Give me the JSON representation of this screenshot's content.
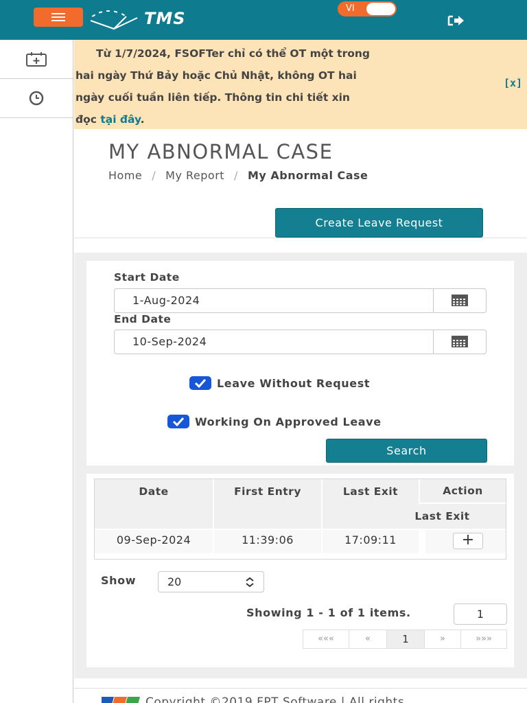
{
  "header": {
    "app_name": "TMS",
    "lang": "VI"
  },
  "notice": {
    "line1": "Từ 1/7/2024, FSOFTer chỉ có thể OT một trong",
    "line2": "hai ngày Thứ Bảy hoặc Chủ Nhật, không OT hai",
    "line3": "ngày cuối tuần liên tiếp. Thông tin chi tiết xin",
    "line4_prefix": "đọc ",
    "link": "tại đây",
    "line4_suffix": ".",
    "close": "[x]"
  },
  "page": {
    "title": "MY ABNORMAL CASE",
    "breadcrumb": {
      "home": "Home",
      "sep": "/",
      "report": "My Report",
      "current": "My Abnormal Case"
    },
    "create_label": "Create Leave Request"
  },
  "filter": {
    "start_label": "Start Date",
    "start_value": "1-Aug-2024",
    "end_label": "End Date",
    "end_value": "10-Sep-2024",
    "chk1": "Leave Without Request",
    "chk2": "Working On Approved Leave",
    "search_label": "Search"
  },
  "table": {
    "headers": {
      "date": "Date",
      "first_entry": "First Entry",
      "last_exit": "Last Exit",
      "action": "Action",
      "action_sub": "Last Exit"
    },
    "rows": [
      {
        "date": "09-Sep-2024",
        "first_entry": "11:39:06",
        "last_exit": "17:09:11",
        "action": "+"
      }
    ]
  },
  "pagination": {
    "show_label": "Show",
    "page_size": "20",
    "showing": "Showing 1 - 1 of 1 items.",
    "page_input": "1",
    "first": "«««",
    "prev": "«",
    "current": "1",
    "next": "»",
    "last": "»»»"
  },
  "footer": {
    "copyright": "Copyright ©2019 FPT Software | All rights"
  },
  "colors": {
    "primary": "#0f7b8e",
    "accent": "#f06b2c",
    "notice_bg": "#fde3b8",
    "checkbox": "#1557d6"
  }
}
